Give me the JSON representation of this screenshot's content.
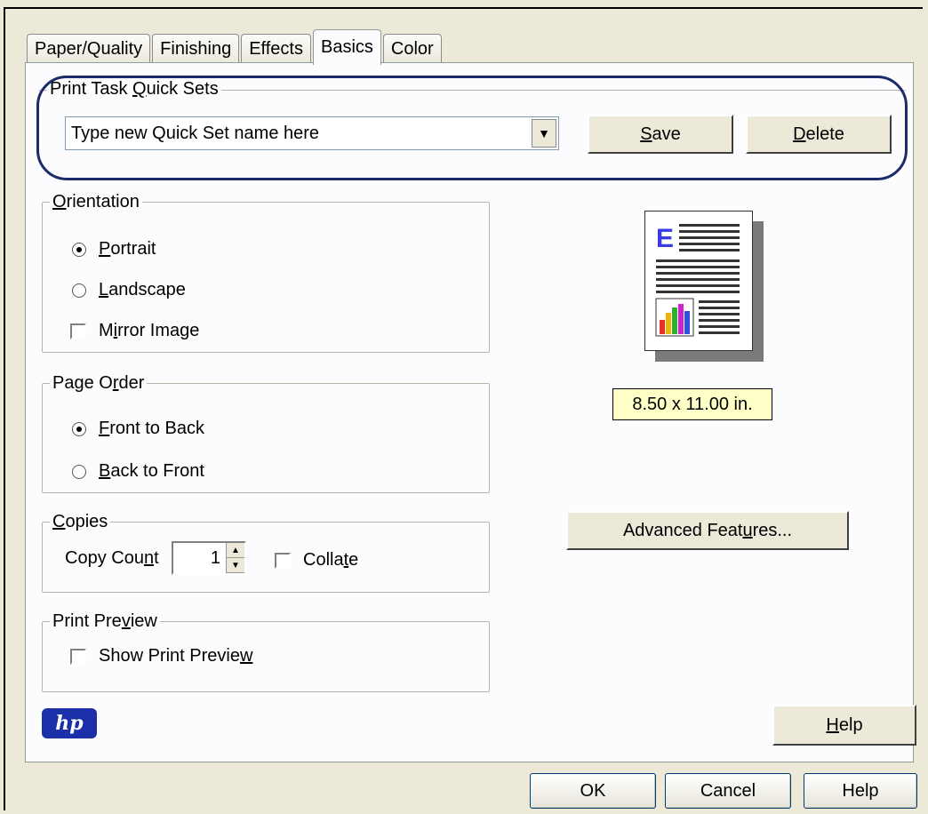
{
  "tabs": [
    {
      "label": "Paper/Quality",
      "active": false
    },
    {
      "label": "Finishing",
      "active": false
    },
    {
      "label": "Effects",
      "active": false
    },
    {
      "label": "Basics",
      "active": true
    },
    {
      "label": "Color",
      "active": false
    }
  ],
  "quick_sets": {
    "legend_pre": "Print Task ",
    "legend_u": "Q",
    "legend_post": "uick Sets",
    "combo_value": "Type new Quick Set name here",
    "save_u": "S",
    "save_post": "ave",
    "delete_u": "D",
    "delete_post": "elete"
  },
  "orientation": {
    "legend_u": "O",
    "legend_post": "rientation",
    "portrait_u": "P",
    "portrait_post": "ortrait",
    "landscape_u": "L",
    "landscape_post": "andscape",
    "mirror_pre": "M",
    "mirror_u": "i",
    "mirror_post": "rror Image",
    "selected": "Portrait"
  },
  "page_order": {
    "legend_pre": "Page O",
    "legend_u": "r",
    "legend_post": "der",
    "front_u": "F",
    "front_post": "ront to Back",
    "back_u": "B",
    "back_post": "ack to Front",
    "selected": "Front to Back"
  },
  "copies": {
    "legend_u": "C",
    "legend_post": "opies",
    "count_pre": "Copy Cou",
    "count_u": "n",
    "count_post": "t",
    "count_value": "1",
    "collate_pre": "Colla",
    "collate_u": "t",
    "collate_post": "e"
  },
  "print_preview": {
    "legend_pre": "Print Pre",
    "legend_u": "v",
    "legend_post": "iew",
    "show_pre": "Show Print Previe",
    "show_u": "w"
  },
  "paper_size": "8.50 x 11.00 in.",
  "advanced_pre": "Advanced Feat",
  "advanced_u": "u",
  "advanced_post": "res...",
  "help_inner_u": "H",
  "help_inner_post": "elp",
  "footer": {
    "ok": "OK",
    "cancel": "Cancel",
    "help": "Help"
  },
  "logo_text": "hp",
  "colors": {
    "highlight": "#1a2a6a",
    "hp_blue": "#1a2fa8",
    "size_bg": "#ffffc8"
  }
}
